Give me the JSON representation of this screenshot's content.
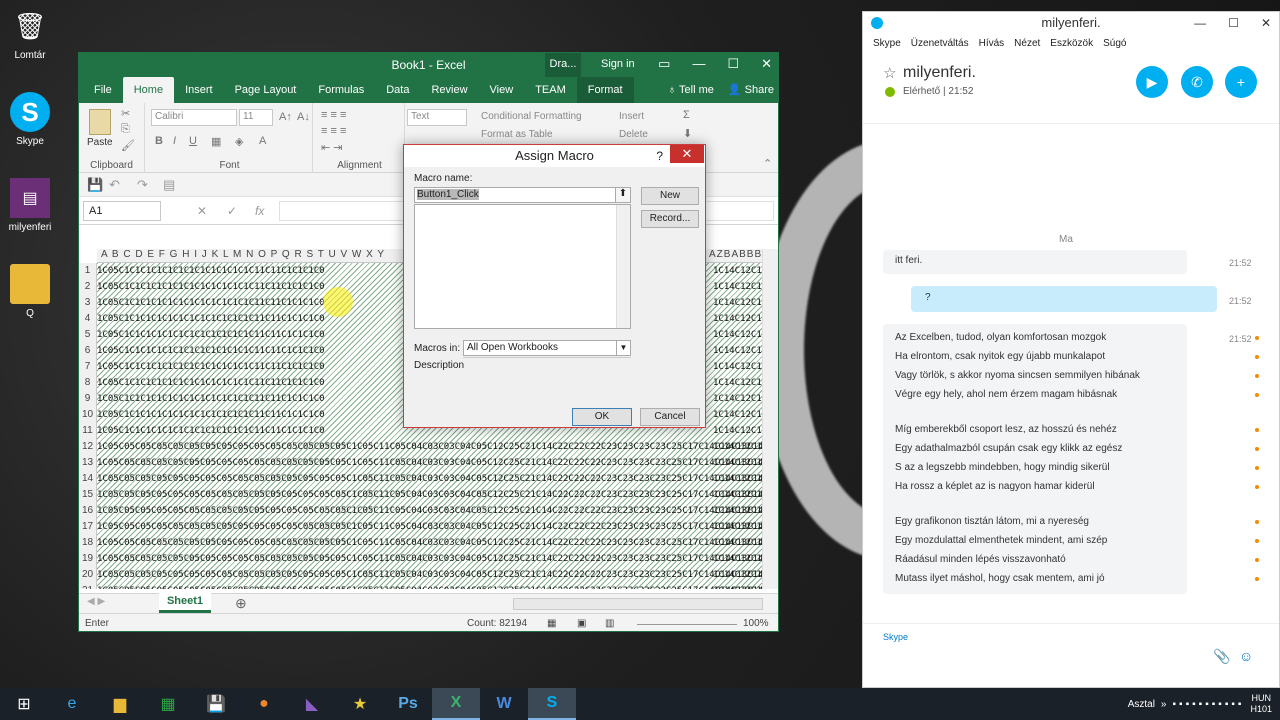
{
  "desktop": {
    "icons": [
      {
        "label": "Lomtár",
        "icon": "recycle-bin-icon"
      },
      {
        "label": "Skype",
        "icon": "skype-icon"
      },
      {
        "label": "milyenferi",
        "icon": "document-icon"
      },
      {
        "label": "Q",
        "icon": "folder-icon"
      }
    ]
  },
  "excel": {
    "title": "Book1 - Excel",
    "context_tab": "Dra...",
    "sign_in": "Sign in",
    "tabs": [
      "File",
      "Home",
      "Insert",
      "Page Layout",
      "Formulas",
      "Data",
      "Review",
      "View",
      "TEAM",
      "Format"
    ],
    "tell_me": "Tell me",
    "share": "Share",
    "ribbon": {
      "clipboard_label": "Clipboard",
      "paste_label": "Paste",
      "font_label": "Font",
      "font_name": "Calibri",
      "font_size": "11",
      "alignment_label": "Alignment",
      "number_format": "Text",
      "conditional_formatting": "Conditional Formatting",
      "format_as_table": "Format as Table",
      "insert": "Insert",
      "delete": "Delete",
      "bold": "B",
      "italic": "I",
      "underline": "U"
    },
    "name_box": "A1",
    "fx": "fx",
    "column_headers": "A B C D E F G H I J K L M N O P Q R S T U V W X Y",
    "column_headers_right": "AZBABBBC",
    "rows": [
      "1",
      "2",
      "3",
      "4",
      "5",
      "6",
      "7",
      "8",
      "9",
      "10",
      "11",
      "12",
      "13",
      "14",
      "15",
      "16",
      "17",
      "18",
      "19",
      "20",
      "21"
    ],
    "cells_left": "1C05C1C1C1C1C1C1C1C1C1C1C1C1C11C11C1C1C1C0",
    "cells_mid": "1C05C05C05C05C05C05C05C05C05C05C05C05C05C05C05C1C05C11C05C04C03C03C04C05C12C25C21C14C22C22C22C23C23C23C23C25C17C14C14C13C14",
    "cells_right": "1C14C12C13",
    "sheet_tab": "Sheet1",
    "status_mode": "Enter",
    "status_count": "Count: 82194",
    "zoom": "100%"
  },
  "dialog": {
    "title": "Assign Macro",
    "help": "?",
    "macro_name_label": "Macro name:",
    "macro_name_value": "Button1_Click",
    "new_button": "New",
    "record_button": "Record...",
    "macros_in_label": "Macros in:",
    "macros_in_value": "All Open Workbooks",
    "description_label": "Description",
    "ok_button": "OK",
    "cancel_button": "Cancel"
  },
  "skype": {
    "window_title": "milyenferi.",
    "menu": [
      "Skype",
      "Üzenetváltás",
      "Hívás",
      "Nézet",
      "Eszközök",
      "Súgó"
    ],
    "contact_name": "milyenferi.",
    "status": "Elérhető | 21:52",
    "day_label": "Ma",
    "messages": [
      {
        "text": "itt feri.",
        "time": "21:52",
        "direction": "in"
      },
      {
        "text": "?",
        "time": "21:52",
        "direction": "out"
      }
    ],
    "poem_time": "21:52",
    "poem_stanzas": [
      [
        "Az Excelben, tudod, olyan komfortosan mozgok",
        "Ha elrontom, csak nyitok egy újabb munkalapot",
        "Vagy törlök, s akkor nyoma sincsen semmilyen hibának",
        "Végre egy hely, ahol nem érzem magam hibásnak"
      ],
      [
        "Míg emberekből csoport lesz, az hosszú és nehéz",
        "Egy adathalmazból csupán csak egy klikk az egész",
        "S az a legszebb mindebben, hogy mindig sikerül",
        "Ha rossz a képlet az is nagyon hamar kiderül"
      ],
      [
        "Egy grafikonon tisztán látom, mi a nyereség",
        "Egy mozdulattal elmenthetek mindent, ami szép",
        "Ráadásul minden lépés visszavonható",
        "Mutass ilyet máshol, hogy csak mentem, ami jó"
      ]
    ],
    "input_label": "Skype"
  },
  "taskbar": {
    "desktop_label": "Asztal",
    "lang": "HUN",
    "kbd": "H101"
  },
  "colors": {
    "excel_green": "#217346",
    "skype_blue": "#00aff0",
    "close_red": "#c8302e"
  }
}
